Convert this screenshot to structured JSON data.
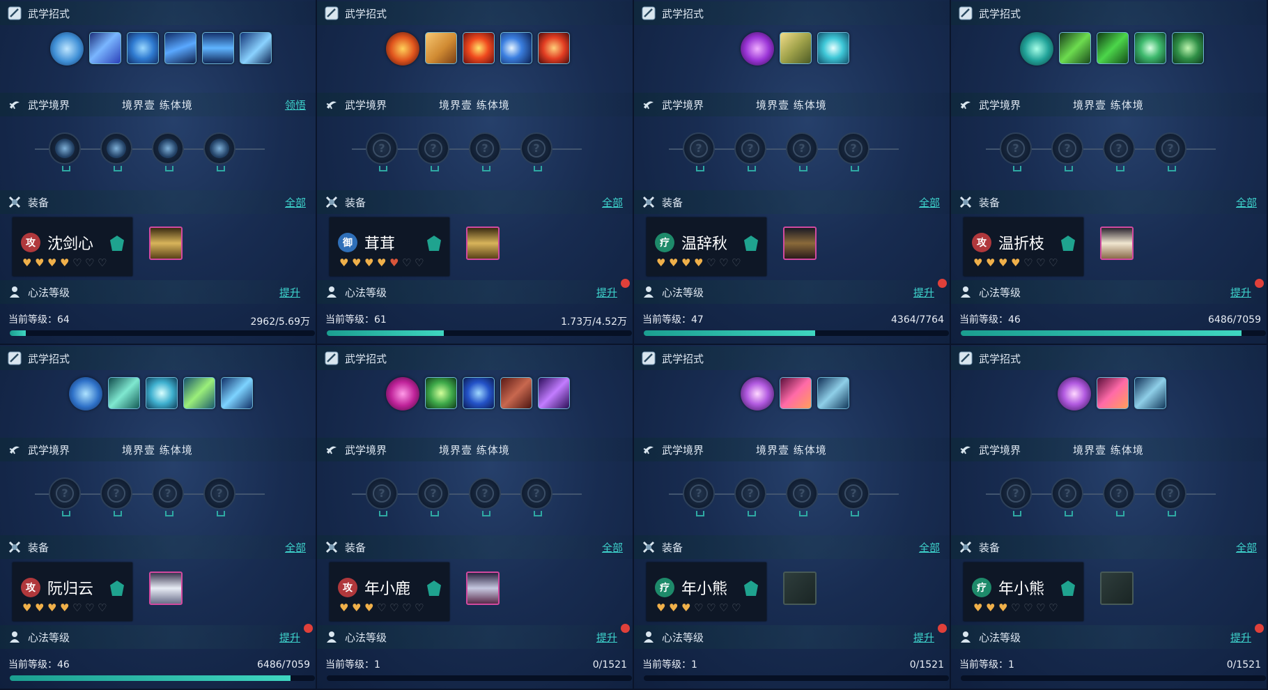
{
  "labels": {
    "skills": "武学招式",
    "realm": "武学境界",
    "equip": "装备",
    "xinfa": "心法等级",
    "equip_link": "全部",
    "xinfa_link": "提升",
    "realm_link": "领悟",
    "realm_text": "境界壹  练体境",
    "level_prefix": "当前等级："
  },
  "colors": {
    "accent": "#3ed3cc",
    "red_dot": "#e0403a",
    "heart_gold": "#f0b04a",
    "heart_empty": "#5a6470"
  },
  "panels": [
    {
      "skill_icons": [
        "wave-orb-icon",
        "blue-slash-icon",
        "blue-vortex-icon",
        "blue-claw-icon",
        "blue-figure-icon",
        "blue-strike-icon"
      ],
      "realm_link": true,
      "nodes_unlocked": true,
      "hero": {
        "name": "沈剑心",
        "faction": "攻",
        "faction_color": "#b0383c",
        "stars": 4,
        "max_stars": 7
      },
      "armor": "gold-armor-icon",
      "xinfa_dot": false,
      "level": "64",
      "exp": "2962/5.69万",
      "progress": 0.052
    },
    {
      "skill_icons": [
        "fire-figure-icon",
        "golden-face-icon",
        "fire-burst-icon",
        "blue-moon-icon",
        "fire-swirl-icon"
      ],
      "realm_link": false,
      "nodes_unlocked": false,
      "hero": {
        "name": "茸茸",
        "faction": "御",
        "faction_color": "#2f6fb8",
        "stars": 4.5,
        "max_stars": 7
      },
      "armor": "gold-armor-icon",
      "xinfa_dot": true,
      "level": "61",
      "exp": "1.73万/4.52万",
      "progress": 0.383
    },
    {
      "skill_icons": [
        "purple-figure-icon",
        "golden-hand-icon",
        "cyan-ring-icon"
      ],
      "realm_link": false,
      "nodes_unlocked": false,
      "hero": {
        "name": "温辞秋",
        "faction": "疗",
        "faction_color": "#1e8a6a",
        "stars": 4,
        "max_stars": 7
      },
      "armor": "dark-armor-icon",
      "xinfa_dot": true,
      "level": "47",
      "exp": "4364/7764",
      "progress": 0.562
    },
    {
      "skill_icons": [
        "green-figure-icon",
        "green-claw-icon",
        "green-slash-icon",
        "green-ring-icon",
        "green-yinyang-icon"
      ],
      "realm_link": false,
      "nodes_unlocked": false,
      "hero": {
        "name": "温折枝",
        "faction": "攻",
        "faction_color": "#b0383c",
        "stars": 4,
        "max_stars": 7
      },
      "armor": "white-armor-icon",
      "xinfa_dot": true,
      "level": "46",
      "exp": "6486/7059",
      "progress": 0.919
    },
    {
      "skill_icons": [
        "blue-wing-icon",
        "teal-wave-icon",
        "teal-spiral-icon",
        "green-star-icon",
        "blue-splash-icon"
      ],
      "realm_link": false,
      "nodes_unlocked": false,
      "hero": {
        "name": "阮归云",
        "faction": "攻",
        "faction_color": "#b0383c",
        "stars": 4,
        "max_stars": 7
      },
      "armor": "white-robe-icon",
      "xinfa_dot": true,
      "level": "46",
      "exp": "6486/7059",
      "progress": 0.919
    },
    {
      "skill_icons": [
        "magenta-rune-icon",
        "green-burst-icon",
        "blue-swirl-icon",
        "red-scales-icon",
        "purple-ghost-icon"
      ],
      "realm_link": false,
      "nodes_unlocked": false,
      "hero": {
        "name": "年小鹿",
        "faction": "攻",
        "faction_color": "#b0383c",
        "stars": 3,
        "max_stars": 7
      },
      "armor": "silver-armor-icon",
      "xinfa_dot": true,
      "level": "1",
      "exp": "0/1521",
      "progress": 0
    },
    {
      "skill_icons": [
        "purple-cone-icon",
        "pink-beast-icon",
        "blue-shark-icon"
      ],
      "realm_link": false,
      "nodes_unlocked": false,
      "hero": {
        "name": "年小熊",
        "faction": "疗",
        "faction_color": "#1e8a6a",
        "stars": 3,
        "max_stars": 7
      },
      "armor": "empty-slot-icon",
      "xinfa_dot": true,
      "level": "1",
      "exp": "0/1521",
      "progress": 0
    },
    {
      "skill_icons": [
        "purple-cone-icon",
        "pink-beast-icon",
        "blue-shark-icon"
      ],
      "realm_link": false,
      "nodes_unlocked": false,
      "hero": {
        "name": "年小熊",
        "faction": "疗",
        "faction_color": "#1e8a6a",
        "stars": 3,
        "max_stars": 7
      },
      "armor": "empty-slot-icon",
      "xinfa_dot": true,
      "level": "1",
      "exp": "0/1521",
      "progress": 0
    }
  ]
}
